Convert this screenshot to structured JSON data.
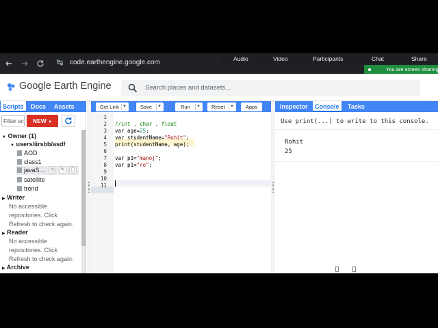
{
  "browser": {
    "url": "code.earthengine.google.com",
    "back_icon": "arrow-left-icon",
    "forward_icon": "arrow-right-icon",
    "reload_icon": "reload-icon"
  },
  "meeting": {
    "items": [
      "Audio",
      "Video",
      "Participants",
      "Chat",
      "Share"
    ],
    "banner": "You are screen sharing"
  },
  "header": {
    "app_title": "Google Earth Engine",
    "search_placeholder": "Search places and datasets..."
  },
  "left_panel": {
    "tabs": [
      "Scripts",
      "Docs",
      "Assets"
    ],
    "active_tab": "Scripts",
    "filter_placeholder": "Filter scripts",
    "new_label": "NEW",
    "tree": {
      "owner": "Owner (1)",
      "repo": "users/iirsbb/asdf",
      "files": [
        "AOD",
        "class1",
        "javaScript",
        "satellite",
        "trend"
      ],
      "selected_file_display": "javaS...",
      "writer": "Writer",
      "writer_note": [
        "No accessible",
        "repositories. Click",
        "Refresh to check again."
      ],
      "reader": "Reader",
      "reader_note": [
        "No accessible",
        "repositories. Click",
        "Refresh to check again."
      ],
      "archive": "Archive"
    }
  },
  "editor": {
    "toolbar": [
      "Get Link",
      "Save",
      "Run",
      "Reset",
      "Apps"
    ],
    "line_numbers": [
      "1",
      "2",
      "3",
      "4",
      "5",
      "6",
      "7",
      "8",
      "9",
      "10",
      "11"
    ],
    "lines": [
      "",
      "//int , char , float",
      "var age=25;",
      "var studentName=\"Rohit\";",
      "print(studentName, age);",
      "",
      "var p1=\"manoj\";",
      "var p1=\"ro\";",
      "",
      "",
      ""
    ]
  },
  "console": {
    "tabs": [
      "Inspector",
      "Console",
      "Tasks"
    ],
    "active_tab": "Console",
    "hint": "Use print(...) to write to this console.",
    "output": [
      "Rohit",
      "25"
    ]
  },
  "colors": {
    "tab_blue": "#4285f4",
    "accent": "#1a73e8",
    "new_red": "#d93025",
    "share_green": "#1e8e3e"
  }
}
